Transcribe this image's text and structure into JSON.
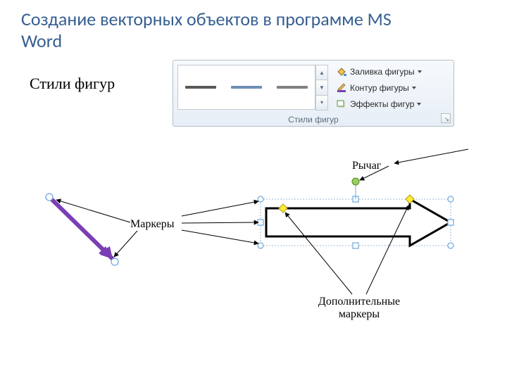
{
  "title": "Создание векторных объектов в программе MS Word",
  "subtitle": "Стили фигур",
  "ribbon": {
    "group_caption": "Стили фигур",
    "btn_fill": "Заливка фигуры",
    "btn_outline": "Контур фигуры",
    "btn_effects": "Эффекты фигур"
  },
  "labels": {
    "markers": "Маркеры",
    "lever": "Рычаг",
    "extra_markers": "Дополнительные маркеры"
  }
}
